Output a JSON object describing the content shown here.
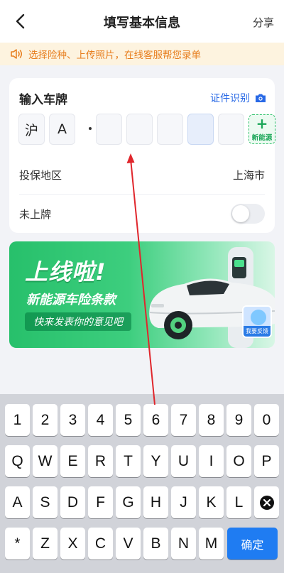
{
  "header": {
    "title": "填写基本信息",
    "share_label": "分享"
  },
  "notice": {
    "text": "选择险种、上传照片，在线客服帮您录单"
  },
  "plate_card": {
    "title": "输入车牌",
    "id_scan_label": "证件识别",
    "province": "沪",
    "letter": "A",
    "new_energy_label": "新能源",
    "region_label": "投保地区",
    "region_value": "上海市",
    "unregistered_label": "未上牌",
    "unregistered_on": false
  },
  "banner": {
    "title": "上线啦!",
    "subtitle": "新能源车险条款",
    "pill": "快来发表你的意见吧",
    "feedback_label": "我要反馈"
  },
  "keyboard": {
    "row1": [
      "1",
      "2",
      "3",
      "4",
      "5",
      "6",
      "7",
      "8",
      "9",
      "0"
    ],
    "row2": [
      "Q",
      "W",
      "E",
      "R",
      "T",
      "Y",
      "U",
      "I",
      "O",
      "P"
    ],
    "row3": [
      "A",
      "S",
      "D",
      "F",
      "G",
      "H",
      "J",
      "K",
      "L"
    ],
    "row4": [
      "*",
      "Z",
      "X",
      "C",
      "V",
      "B",
      "N",
      "M"
    ],
    "confirm_label": "确定"
  },
  "colors": {
    "accent": "#2869e6",
    "notice_text": "#e77d1d",
    "notice_bg": "#fdf3df",
    "green": "#27c06b",
    "confirm": "#1f7cf2",
    "arrow": "#e0262c"
  }
}
